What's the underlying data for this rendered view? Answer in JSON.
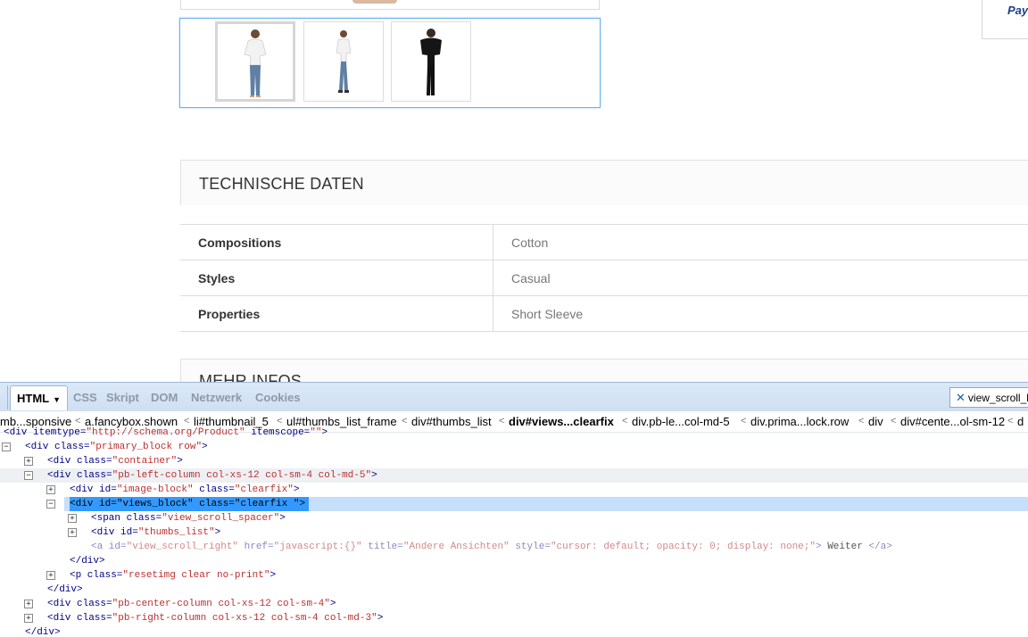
{
  "page": {
    "paypal_text": "Pay",
    "thumbnails": [
      {
        "name": "thumbnail-1",
        "garment": "white-top-jeans",
        "selected": true
      },
      {
        "name": "thumbnail-2",
        "garment": "white-top-jeans",
        "selected": false
      },
      {
        "name": "thumbnail-3",
        "garment": "black-top-black-pants",
        "selected": false
      }
    ],
    "tech_section_title": "TECHNISCHE DATEN",
    "specs": [
      {
        "key": "Compositions",
        "value": "Cotton"
      },
      {
        "key": "Styles",
        "value": "Casual"
      },
      {
        "key": "Properties",
        "value": "Short Sleeve"
      }
    ],
    "more_section_title": "MEHR INFOS"
  },
  "devtools": {
    "tabs": [
      {
        "label": "HTML",
        "active": true
      },
      {
        "label": "CSS"
      },
      {
        "label": "Skript"
      },
      {
        "label": "DOM"
      },
      {
        "label": "Netzwerk"
      },
      {
        "label": "Cookies"
      }
    ],
    "search_value": "view_scroll_le",
    "breadcrumbs": [
      "mb...sponsive",
      "a.fancybox.shown",
      "li#thumbnail_5",
      "ul#thumbs_list_frame",
      "div#thumbs_list",
      "div#views...clearfix",
      "div.pb-le...col-md-5",
      "div.prima...lock.row",
      "div",
      "div#cente...ol-sm-12",
      "d"
    ],
    "tree": [
      {
        "tag": "div",
        "attrs": [
          [
            "itemtype",
            "http://schema.org/Product"
          ],
          [
            "itemscope",
            ""
          ]
        ]
      },
      {
        "tag": "div",
        "attrs": [
          [
            "class",
            "primary_block row"
          ]
        ]
      },
      {
        "tag": "div",
        "attrs": [
          [
            "class",
            "container"
          ]
        ]
      },
      {
        "tag": "div",
        "attrs": [
          [
            "class",
            "pb-left-column col-xs-12 col-sm-4 col-md-5"
          ]
        ]
      },
      {
        "tag": "div",
        "attrs": [
          [
            "id",
            "image-block"
          ],
          [
            "class",
            "clearfix"
          ]
        ]
      },
      {
        "tag": "div",
        "attrs": [
          [
            "id",
            "views_block"
          ],
          [
            "class",
            "clearfix "
          ]
        ]
      },
      {
        "tag": "span",
        "attrs": [
          [
            "class",
            "view_scroll_spacer"
          ]
        ]
      },
      {
        "tag": "div",
        "attrs": [
          [
            "id",
            "thumbs_list"
          ]
        ]
      },
      {
        "tag": "a",
        "attrs": [
          [
            "id",
            "view_scroll_right"
          ],
          [
            "href",
            "javascript:{}"
          ],
          [
            "title",
            "Andere Ansichten"
          ],
          [
            "style",
            "cursor: default; opacity: 0; display: none;"
          ]
        ],
        "text": "Weiter"
      },
      {
        "close": "div"
      },
      {
        "tag": "p",
        "attrs": [
          [
            "class",
            "resetimg clear no-print"
          ]
        ]
      },
      {
        "close": "div"
      },
      {
        "tag": "div",
        "attrs": [
          [
            "class",
            "pb-center-column col-xs-12 col-sm-4"
          ]
        ]
      },
      {
        "tag": "div",
        "attrs": [
          [
            "class",
            "pb-right-column col-xs-12 col-sm-4 col-md-3"
          ]
        ]
      },
      {
        "close": "div"
      }
    ]
  }
}
